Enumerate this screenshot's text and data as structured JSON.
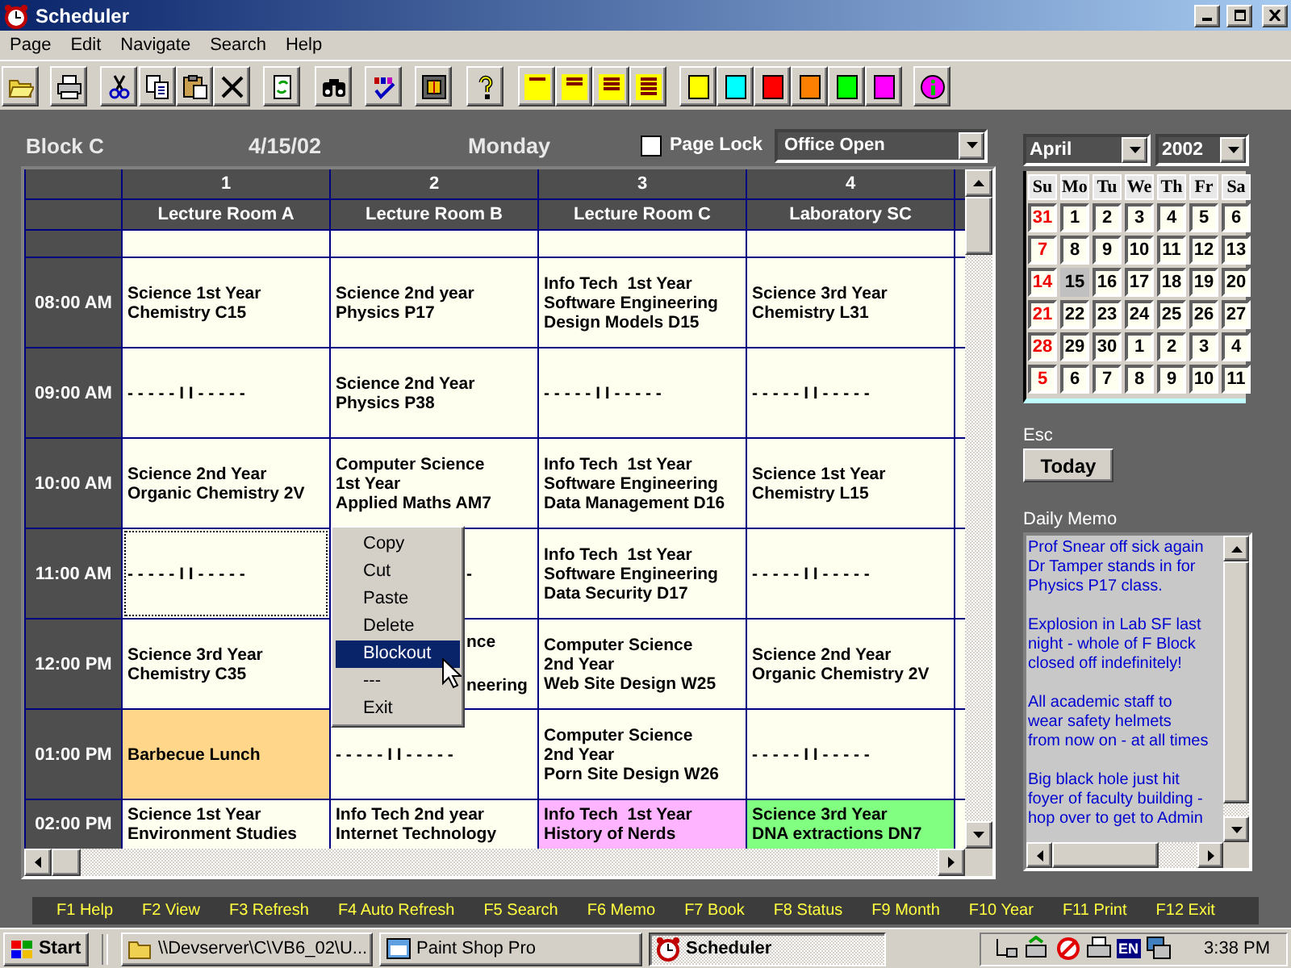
{
  "window": {
    "title": "Scheduler"
  },
  "menu": [
    "Page",
    "Edit",
    "Navigate",
    "Search",
    "Help"
  ],
  "toolbar": {
    "color_buttons": [
      {
        "color": "#ffff00"
      },
      {
        "color": "#00ffff"
      },
      {
        "color": "#ff0000"
      },
      {
        "color": "#ff8000"
      },
      {
        "color": "#00ff00"
      },
      {
        "color": "#ff00ff"
      }
    ]
  },
  "header": {
    "block": "Block C",
    "date": "4/15/02",
    "day": "Monday",
    "page_lock": {
      "label": "Page Lock",
      "checked": false
    },
    "status_select": {
      "value": "Office Open"
    }
  },
  "schedule": {
    "columns": [
      {
        "number": "1",
        "room": "Lecture Room A"
      },
      {
        "number": "2",
        "room": "Lecture Room B"
      },
      {
        "number": "3",
        "room": "Lecture Room C"
      },
      {
        "number": "4",
        "room": "Laboratory SC"
      }
    ],
    "rows": [
      {
        "time": "08:00 AM",
        "cells": [
          {
            "kind": "entry",
            "lines": [
              "Science 1st Year",
              "Chemistry C15"
            ],
            "selected": false
          },
          {
            "kind": "entry",
            "lines": [
              "Science 2nd year",
              "Physics P17"
            ],
            "selected": false
          },
          {
            "kind": "entry",
            "lines": [
              "Info Tech  1st Year",
              "Software Engineering",
              "Design Models D15"
            ],
            "selected": false
          },
          {
            "kind": "entry",
            "lines": [
              "Science 3rd Year",
              "Chemistry L31"
            ],
            "selected": false
          }
        ]
      },
      {
        "time": "09:00 AM",
        "cells": [
          {
            "kind": "entry",
            "lines": [
              "- - - - - I I - - - - -"
            ],
            "selected": false
          },
          {
            "kind": "entry",
            "lines": [
              "Science 2nd Year",
              "Physics P38"
            ],
            "selected": false
          },
          {
            "kind": "entry",
            "lines": [
              "- - - - - I I - - - - -"
            ],
            "selected": false
          },
          {
            "kind": "entry",
            "lines": [
              "- - - - - I I - - - - -"
            ],
            "selected": false
          }
        ]
      },
      {
        "time": "10:00 AM",
        "cells": [
          {
            "kind": "entry",
            "lines": [
              "Science 2nd Year",
              "Organic Chemistry 2V"
            ],
            "selected": false
          },
          {
            "kind": "entry",
            "lines": [
              "Computer Science",
              "1st Year",
              "Applied Maths AM7"
            ],
            "selected": false
          },
          {
            "kind": "entry",
            "lines": [
              "Info Tech  1st Year",
              "Software Engineering",
              "Data Management D16"
            ],
            "selected": false
          },
          {
            "kind": "entry",
            "lines": [
              "Science 1st Year",
              "Chemistry L15"
            ],
            "selected": false
          }
        ]
      },
      {
        "time": "11:00 AM",
        "cells": [
          {
            "kind": "entry",
            "lines": [
              "- - - - - I I - - - - -"
            ],
            "selected": true
          },
          {
            "kind": "partial",
            "lines": [
              "-"
            ],
            "selected": false
          },
          {
            "kind": "entry",
            "lines": [
              "Info Tech  1st Year",
              "Software Engineering",
              "Data Security D17"
            ],
            "selected": false
          },
          {
            "kind": "entry",
            "lines": [
              "- - - - - I I - - - - -"
            ],
            "selected": false
          }
        ]
      },
      {
        "time": "12:00 PM",
        "cells": [
          {
            "kind": "entry",
            "lines": [
              "Science 3rd Year",
              "Chemistry C35"
            ],
            "selected": false
          },
          {
            "kind": "partial",
            "lines": [
              "nce",
              "neering"
            ],
            "selected": false
          },
          {
            "kind": "entry",
            "lines": [
              "Computer Science",
              "2nd Year",
              "Web Site Design W25"
            ],
            "selected": false
          },
          {
            "kind": "entry",
            "lines": [
              "Science 2nd Year",
              "Organic Chemistry 2V"
            ],
            "selected": false
          }
        ]
      },
      {
        "time": "01:00 PM",
        "cells": [
          {
            "kind": "entry",
            "lines": [
              "Barbecue Lunch"
            ],
            "selected": false,
            "color": "#ffd68a"
          },
          {
            "kind": "entry",
            "lines": [
              "- - - - - I I - - - - -"
            ],
            "selected": false
          },
          {
            "kind": "entry",
            "lines": [
              "Computer Science",
              "2nd Year",
              "Porn Site Design W26"
            ],
            "selected": false
          },
          {
            "kind": "entry",
            "lines": [
              "- - - - - I I - - - - -"
            ],
            "selected": false
          }
        ]
      },
      {
        "time": "02:00 PM",
        "cells": [
          {
            "kind": "entry",
            "lines": [
              "Science 1st Year",
              "Environment Studies"
            ],
            "selected": false
          },
          {
            "kind": "entry",
            "lines": [
              "Info Tech 2nd year",
              "Internet Technology"
            ],
            "selected": false
          },
          {
            "kind": "entry",
            "lines": [
              "Info Tech  1st Year",
              "History of Nerds"
            ],
            "selected": false,
            "color": "#ffb4ff"
          },
          {
            "kind": "entry",
            "lines": [
              "Science 3rd Year",
              "DNA extractions DN7"
            ],
            "selected": false,
            "color": "#80ff80"
          }
        ]
      }
    ]
  },
  "context_menu": {
    "items": [
      {
        "label": "Copy",
        "selected": false
      },
      {
        "label": "Cut",
        "selected": false
      },
      {
        "label": "Paste",
        "selected": false
      },
      {
        "label": "Delete",
        "selected": false
      },
      {
        "label": "Blockout",
        "selected": true
      },
      {
        "label": "---",
        "selected": false
      },
      {
        "label": "Exit",
        "selected": false
      }
    ]
  },
  "calendar": {
    "month": "April",
    "year": "2002",
    "weekdays": [
      "Su",
      "Mo",
      "Tu",
      "We",
      "Th",
      "Fr",
      "Sa"
    ],
    "days": [
      {
        "day": "31",
        "selected": false
      },
      {
        "day": "1",
        "selected": false
      },
      {
        "day": "2",
        "selected": false
      },
      {
        "day": "3",
        "selected": false
      },
      {
        "day": "4",
        "selected": false
      },
      {
        "day": "5",
        "selected": false
      },
      {
        "day": "6",
        "selected": false
      },
      {
        "day": "7",
        "selected": false
      },
      {
        "day": "8",
        "selected": false
      },
      {
        "day": "9",
        "selected": false
      },
      {
        "day": "10",
        "selected": false
      },
      {
        "day": "11",
        "selected": false
      },
      {
        "day": "12",
        "selected": false
      },
      {
        "day": "13",
        "selected": false
      },
      {
        "day": "14",
        "selected": false
      },
      {
        "day": "15",
        "selected": true
      },
      {
        "day": "16",
        "selected": false
      },
      {
        "day": "17",
        "selected": false
      },
      {
        "day": "18",
        "selected": false
      },
      {
        "day": "19",
        "selected": false
      },
      {
        "day": "20",
        "selected": false
      },
      {
        "day": "21",
        "selected": false
      },
      {
        "day": "22",
        "selected": false
      },
      {
        "day": "23",
        "selected": false
      },
      {
        "day": "24",
        "selected": false
      },
      {
        "day": "25",
        "selected": false
      },
      {
        "day": "26",
        "selected": false
      },
      {
        "day": "27",
        "selected": false
      },
      {
        "day": "28",
        "selected": false
      },
      {
        "day": "29",
        "selected": false
      },
      {
        "day": "30",
        "selected": false
      },
      {
        "day": "1",
        "selected": false
      },
      {
        "day": "2",
        "selected": false
      },
      {
        "day": "3",
        "selected": false
      },
      {
        "day": "4",
        "selected": false
      },
      {
        "day": "5",
        "selected": false
      },
      {
        "day": "6",
        "selected": false
      },
      {
        "day": "7",
        "selected": false
      },
      {
        "day": "8",
        "selected": false
      },
      {
        "day": "9",
        "selected": false
      },
      {
        "day": "10",
        "selected": false
      },
      {
        "day": "11",
        "selected": false
      }
    ]
  },
  "esc_label": "Esc",
  "today_button": "Today",
  "memo": {
    "label": "Daily Memo",
    "paragraphs": [
      [
        "Prof Snear off sick again",
        "Dr Tamper stands in for",
        "Physics P17 class."
      ],
      [
        "Explosion in Lab SF last",
        "night - whole of F Block",
        "closed off indefinitely!"
      ],
      [
        "All academic staff to",
        "wear safety helmets",
        "from now on - at all times"
      ],
      [
        "Big black hole just hit",
        "foyer of faculty building -",
        "hop over to get to Admin"
      ]
    ]
  },
  "function_keys": [
    "F1 Help",
    "F2 View",
    "F3 Refresh",
    "F4 Auto Refresh",
    "F5 Search",
    "F6 Memo",
    "F7 Book",
    "F8 Status",
    "F9 Month",
    "F10 Year",
    "F11 Print",
    "F12 Exit"
  ],
  "taskbar": {
    "start": "Start",
    "tasks": [
      {
        "label": "\\\\Devserver\\C\\VB6_02\\U...",
        "selected": false
      },
      {
        "label": "Paint Shop Pro",
        "selected": false
      },
      {
        "label": "Scheduler",
        "selected": true
      }
    ],
    "tray_lang": "EN",
    "clock": "3:38 PM"
  }
}
